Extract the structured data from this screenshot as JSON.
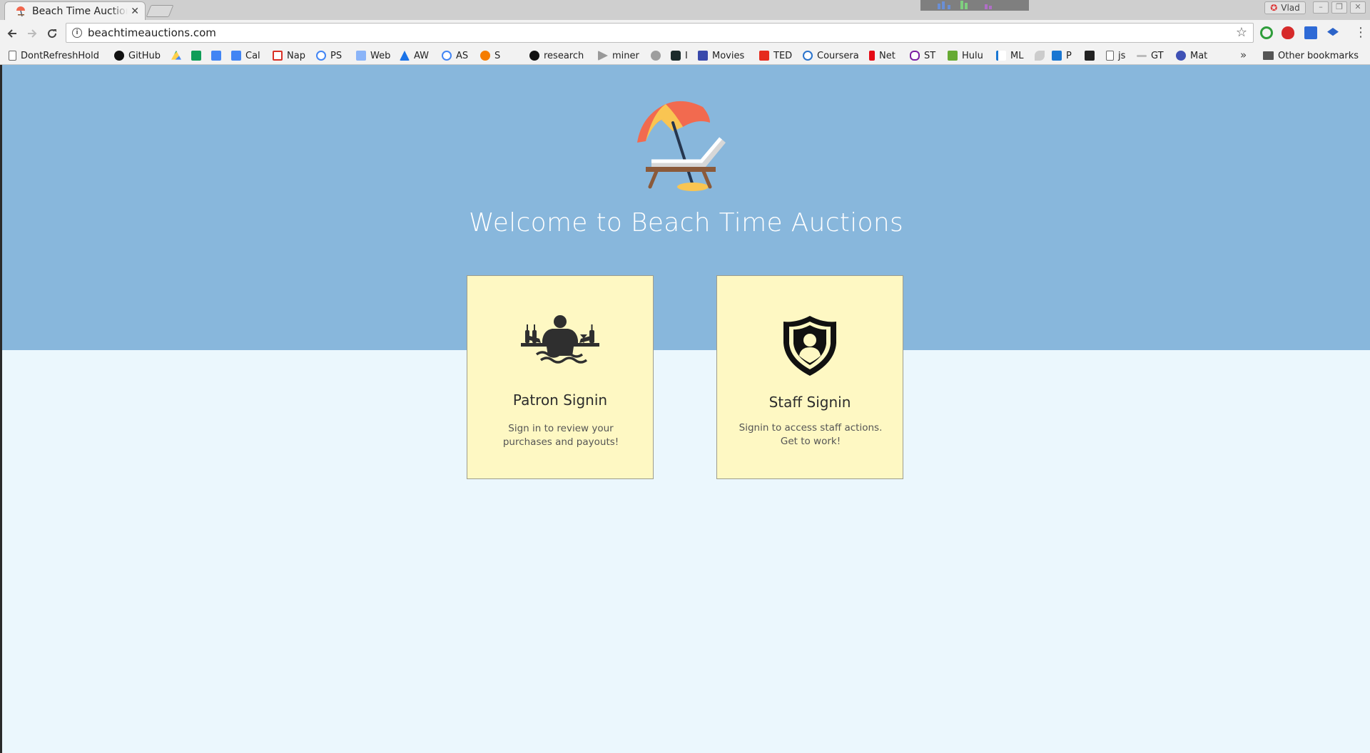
{
  "browser": {
    "tab": {
      "title": "Beach Time Auctions",
      "close": "✕"
    },
    "address": {
      "url": "beachtimeauctions.com"
    },
    "profile": {
      "name": "Vlad"
    },
    "bookmarks": [
      {
        "label": "DontRefreshHold",
        "icon": "page-icon"
      },
      {
        "label": "GitHub",
        "icon": "github-icon"
      },
      {
        "label": "",
        "icon": "drive-icon"
      },
      {
        "label": "",
        "icon": "sheets-icon"
      },
      {
        "label": "",
        "icon": "docs-icon"
      },
      {
        "label": "Cal",
        "icon": "calendar-icon"
      },
      {
        "label": "Nap",
        "icon": "gmail-icon"
      },
      {
        "label": "PS",
        "icon": "google-icon"
      },
      {
        "label": "Web",
        "icon": "web-icon"
      },
      {
        "label": "AW",
        "icon": "adwords-icon"
      },
      {
        "label": "AS",
        "icon": "google-icon"
      },
      {
        "label": "S",
        "icon": "cloud-icon"
      },
      {
        "label": "research",
        "icon": "github-icon"
      },
      {
        "label": "miner",
        "icon": "miner-icon"
      },
      {
        "label": "",
        "icon": "globe-icon"
      },
      {
        "label": "I",
        "icon": "dark-square-icon"
      },
      {
        "label": "Movies",
        "icon": "film-icon"
      },
      {
        "label": "TED",
        "icon": "ted-icon"
      },
      {
        "label": "Coursera",
        "icon": "coursera-icon"
      },
      {
        "label": "Net",
        "icon": "netflix-icon"
      },
      {
        "label": "ST",
        "icon": "bracket-icon"
      },
      {
        "label": "Hulu",
        "icon": "hulu-icon"
      },
      {
        "label": "ML",
        "icon": "k-icon"
      },
      {
        "label": "",
        "icon": "leaf-icon"
      },
      {
        "label": "P",
        "icon": "paypal-icon"
      },
      {
        "label": "",
        "icon": "z-icon"
      },
      {
        "label": "js",
        "icon": "page-icon"
      },
      {
        "label": "GT",
        "icon": "gt-icon"
      },
      {
        "label": "Mat",
        "icon": "shield-small-icon"
      }
    ],
    "bookmarks_more": "»",
    "other_bookmarks": "Other bookmarks"
  },
  "page": {
    "welcome": "Welcome to Beach Time Auctions",
    "cards": [
      {
        "title": "Patron Signin",
        "description": "Sign in to review your purchases and payouts!",
        "icon": "patron-beach-bar-icon"
      },
      {
        "title": "Staff Signin",
        "description": "Signin to access staff actions. Get to work!",
        "icon": "staff-shield-icon"
      }
    ]
  },
  "colors": {
    "hero": "#88b7dc",
    "background": "#ebf7fd",
    "card": "#fef8c3"
  }
}
